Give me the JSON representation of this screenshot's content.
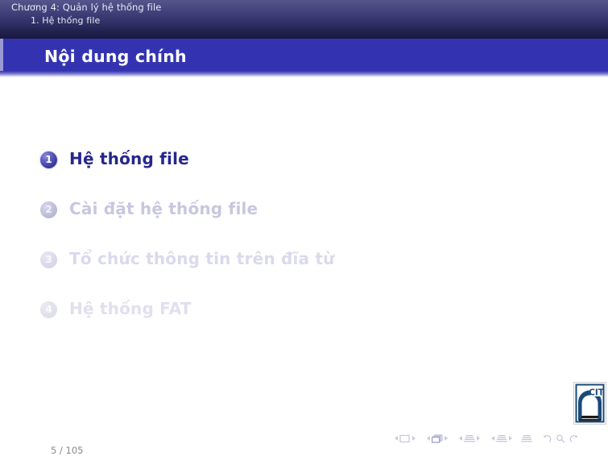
{
  "header": {
    "chapter": "Chương 4: Quản lý hệ thống file",
    "section": "1. Hệ thống file"
  },
  "title_bar": {
    "title": "Nội dung chính",
    "band_color": "#3333b2"
  },
  "toc": {
    "items": [
      {
        "number": "1",
        "label": "Hệ thống file",
        "state": "active"
      },
      {
        "number": "2",
        "label": "Cài đặt hệ thống file",
        "state": "dimmed"
      },
      {
        "number": "3",
        "label": "Tổ chức thông tin trên đĩa từ",
        "state": "dimmed"
      },
      {
        "number": "4",
        "label": "Hệ thống FAT",
        "state": "dimmed"
      }
    ]
  },
  "footer": {
    "page_current": "5",
    "page_separator": "/",
    "page_total": "105",
    "page_indicator": "5 /  105"
  },
  "nav_symbols": {
    "items": [
      {
        "icon": "slide-icon",
        "prev": "prev-slide-icon",
        "next": "next-slide-icon"
      },
      {
        "icon": "frames-icon",
        "prev": "prev-frame-icon",
        "next": "next-frame-icon"
      },
      {
        "icon": "subsection-icon",
        "prev": "prev-subsection-icon",
        "next": "next-subsection-icon"
      },
      {
        "icon": "section-icon",
        "prev": "prev-section-icon",
        "next": "next-section-icon"
      },
      {
        "icon": "presentation-icon"
      },
      {
        "icon": "back-arrow-icon"
      },
      {
        "icon": "search-icon"
      },
      {
        "icon": "forward-arrow-icon"
      }
    ]
  },
  "logo": {
    "name": "institution-logo",
    "text": "CIT"
  },
  "colors": {
    "header_top": "#55558c",
    "header_bottom": "#191940",
    "accent": "#3333b2",
    "active_text": "#26268c",
    "dim_text": "#c7c7e0",
    "page_text": "#8a8a8a"
  }
}
